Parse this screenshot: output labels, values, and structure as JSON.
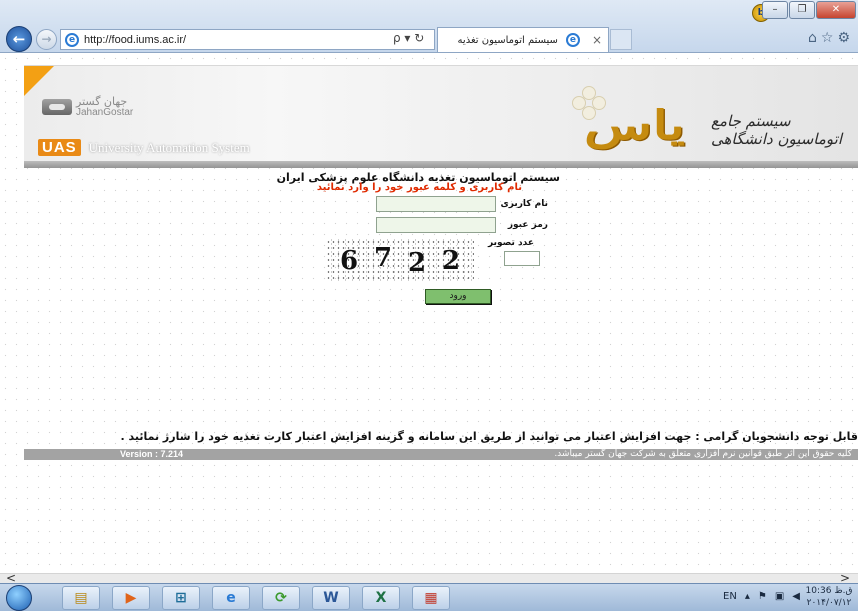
{
  "browser": {
    "url": "http://food.iums.ac.ir/",
    "tab_title": "سیستم اتوماسیون تغذیه",
    "tab_close": "×",
    "search_refresh": "ρ ▾ ↻",
    "back_glyph": "←",
    "forward_glyph": "→",
    "icons": [
      "home-icon",
      "star-icon",
      "gear-icon"
    ],
    "window_controls": {
      "minimize": "–",
      "maximize": "❐",
      "close": "✕"
    }
  },
  "banner": {
    "jahan_fa": "جهان گستر",
    "jahan_en": "JahanGostar",
    "uas_logo": "UAS",
    "uas_title": "University Automation System",
    "yas_logo": "یاس",
    "yas_subtitle": "سیستم جامع اتوماسیون دانشگاهی"
  },
  "login": {
    "system_title": "سیستم اتوماسیون تغذیه دانشگاه علوم پزشکی ایران",
    "hint": "نام کاربری و کلمه عبور خود را وارد نمائید",
    "username_label": "نام کاربری",
    "username_value": "",
    "password_label": "رمز عبور",
    "password_value": "",
    "captcha_label": "عدد تصویر",
    "captcha_value": "",
    "captcha_digits": [
      "6",
      "7",
      "2",
      "2"
    ],
    "submit_label": "ورود"
  },
  "notice": "قابل توجه دانشجویان گرامی : جهت افزایش اعتبار می توانید از طریق این سامانه و گزینه افزایش اعتبار کارت تغذیه خود را شارژ نمائید .",
  "footer": {
    "version": "Version : 7.214",
    "copyright": "کلیه حقوق این اثر طبق قوانین نرم افزاری متعلق به شرکت جهان گستر میباشد."
  },
  "scrollbar": {
    "left_arrow": "<",
    "right_arrow": ">"
  },
  "taskbar": {
    "items": [
      "file-explorer-icon",
      "media-player-icon",
      "network-app-icon",
      "internet-explorer-icon",
      "photo-app-icon",
      "word-icon",
      "excel-icon",
      "app-grid-icon"
    ],
    "item_glyphs": [
      "▤",
      "▶",
      "⊞",
      "e",
      "⟳",
      "W",
      "X",
      "▦"
    ],
    "language": "EN",
    "clock_time": "10:36 ق.ظ",
    "clock_date": "۲۰۱۴/۰۷/۱۲"
  },
  "colors": {
    "accent_orange": "#f3a014",
    "hint_red": "#e02a00",
    "button_green": "#7fbf6e",
    "footer_gray": "#a3a3a3"
  }
}
